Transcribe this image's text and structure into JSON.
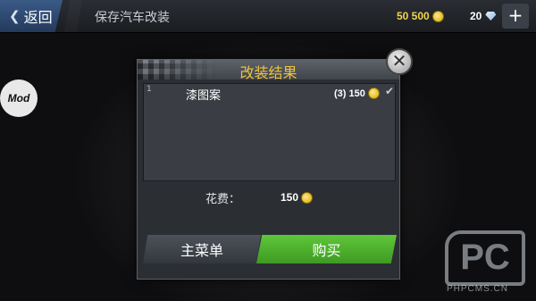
{
  "topbar": {
    "back_label": "返回",
    "title": "保存汽车改装",
    "coins": "50 500",
    "gems": "20",
    "add_label": "+"
  },
  "side": {
    "mod_label": "Mod"
  },
  "dialog": {
    "title": "改装结果",
    "close_icon": "close-icon",
    "items": [
      {
        "index": "1",
        "name": "漆图案",
        "price": "(3) 150",
        "checked": true
      }
    ],
    "cost_label": "花费：",
    "cost_value": "150",
    "menu_button": "主菜单",
    "buy_button": "购买"
  },
  "watermark": {
    "logo": "PC",
    "url": "PHPCMS.CN"
  },
  "colors": {
    "accent_title": "#f0c23a",
    "buy_green": "#4fb52e",
    "coin_gold": "#f2d44a"
  }
}
